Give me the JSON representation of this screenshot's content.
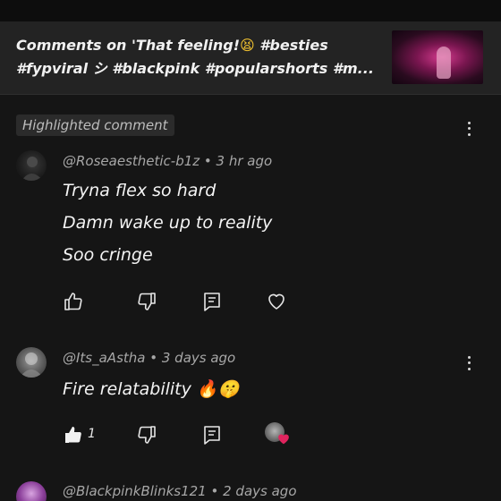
{
  "header": {
    "title_line1": "Comments on 'That feeling!",
    "title_emoji": "😫",
    "title_line1_tags": " #besties",
    "title_line2": "#fypviral シ #blackpink #popularshorts #m..."
  },
  "highlighted_badge": "Highlighted comment",
  "comments": [
    {
      "author": "@Roseaesthetic-b1z",
      "time": "3 hr ago",
      "lines": [
        "Tryna flex so hard",
        "Damn wake up to reality",
        "Soo cringe"
      ],
      "like_count": ""
    },
    {
      "author": "@Its_aAstha",
      "time": "3 days ago",
      "lines": [
        "Fire relatability 🔥🤫"
      ],
      "like_count": "1"
    },
    {
      "author": "@BlackpinkBlinks121",
      "time": "2 days ago",
      "lines": [],
      "like_count": ""
    }
  ],
  "icons": {
    "like": "thumbs-up-icon",
    "dislike": "thumbs-down-icon",
    "reply": "reply-icon",
    "heart": "heart-icon",
    "more": "more-vertical-icon"
  },
  "colors": {
    "background": "#151515",
    "header": "#232323",
    "heart_badge": "#e0245e"
  }
}
